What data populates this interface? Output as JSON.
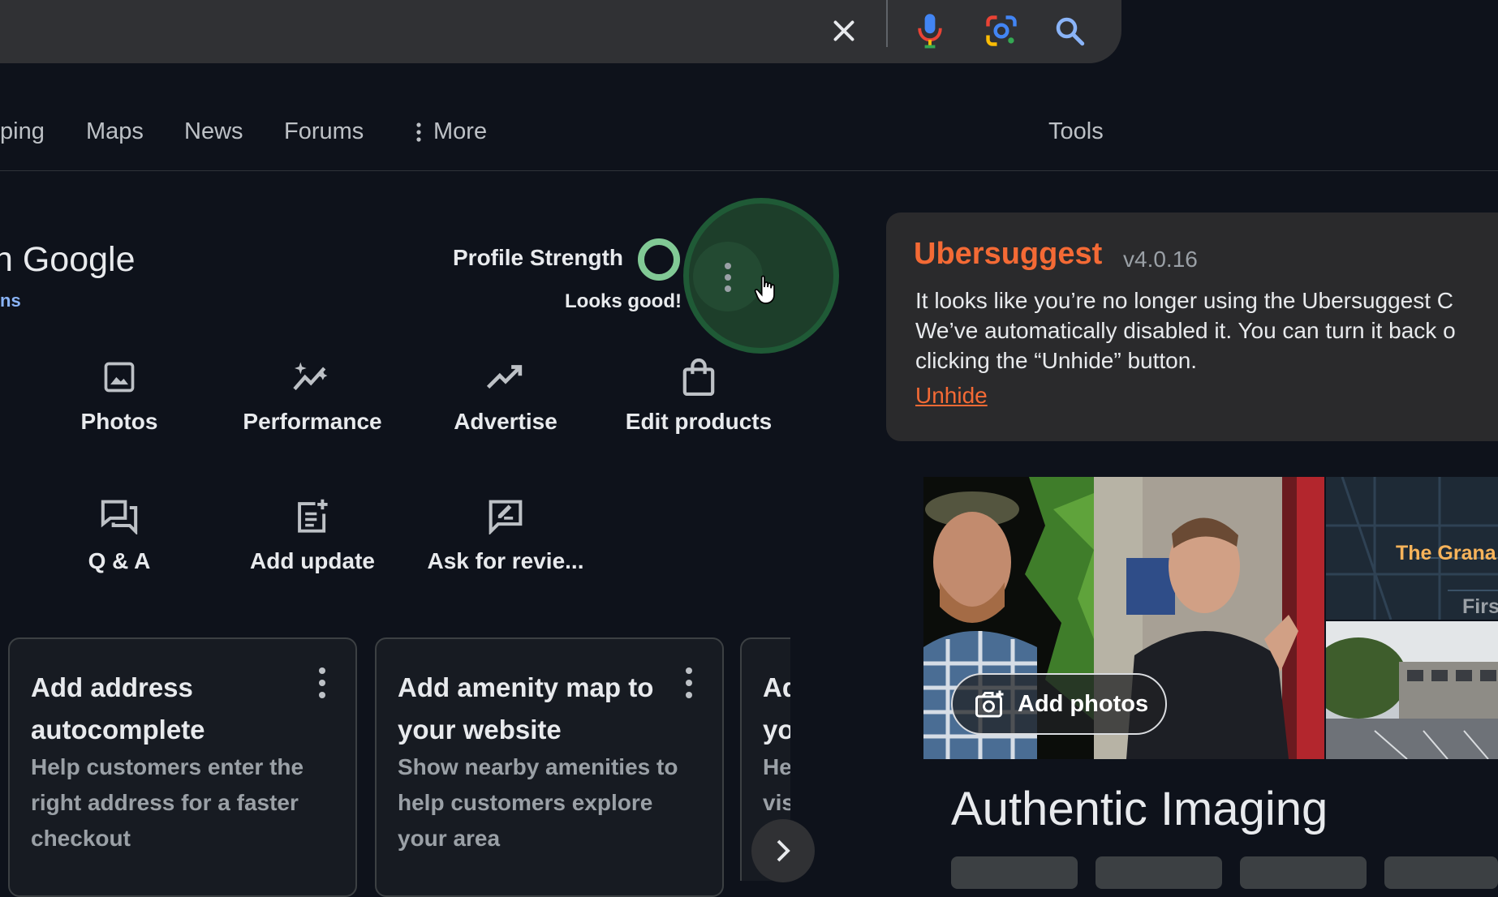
{
  "search": {
    "clear_icon": "close-icon",
    "voice_icon": "microphone-icon",
    "lens_icon": "google-lens-icon",
    "search_icon": "search-icon"
  },
  "nav": {
    "tabs": [
      "ping",
      "Maps",
      "News",
      "Forums"
    ],
    "more_label": "More",
    "tools_label": "Tools"
  },
  "business_profile": {
    "title_fragment": "n Google",
    "link_fragment": "ns",
    "profile_strength_label": "Profile Strength",
    "profile_strength_status": "Looks good!",
    "accent_color": "#81c995",
    "actions": [
      {
        "label": "Photos",
        "icon": "photo-icon"
      },
      {
        "label": "Performance",
        "icon": "performance-icon"
      },
      {
        "label": "Advertise",
        "icon": "trending-up-icon"
      },
      {
        "label": "Edit products",
        "icon": "shopping-bag-icon"
      },
      {
        "label": "Q & A",
        "icon": "forum-icon"
      },
      {
        "label": "Add update",
        "icon": "post-add-icon"
      },
      {
        "label": "Ask for revie...",
        "icon": "rate-review-icon"
      }
    ]
  },
  "cards": [
    {
      "title": "Add address autocomplete",
      "description": "Help customers enter the right address for a faster checkout"
    },
    {
      "title": "Add amenity map to your website",
      "description": "Show nearby amenities to help customers explore your area"
    },
    {
      "title": "Ad yo",
      "description": "He vis"
    }
  ],
  "ubersuggest": {
    "title": "Ubersuggest",
    "version": "v4.0.16",
    "message": "It looks like you’re no longer using the Ubersuggest C\nWe’ve automatically disabled it. You can turn it back o\nclicking the “Unhide” button.",
    "link": "Unhide",
    "brand_color": "#f46a35"
  },
  "knowledge_panel": {
    "map_label_1": "The Grana",
    "map_label_2": "Firs",
    "add_photos_label": "Add photos",
    "business_name": "Authentic Imaging"
  }
}
